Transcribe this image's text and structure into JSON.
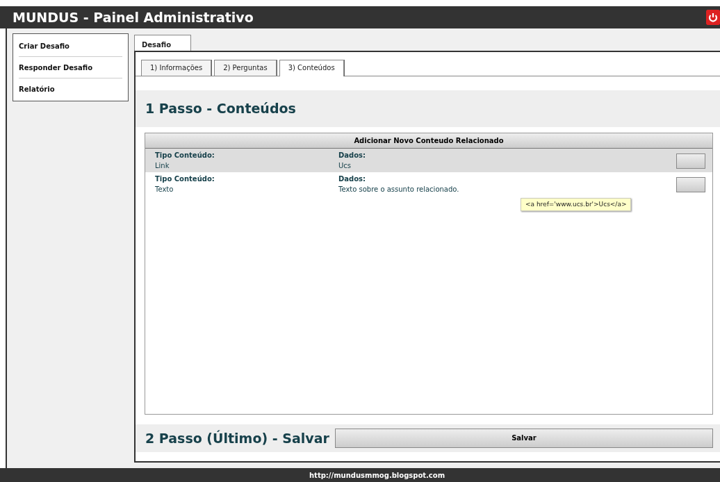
{
  "header": {
    "title": "MUNDUS - Painel Administrativo"
  },
  "sidebar": {
    "items": [
      {
        "label": "Criar Desafio"
      },
      {
        "label": "Responder Desafio"
      },
      {
        "label": "Relatório"
      }
    ]
  },
  "main_tabs": [
    {
      "label": "Desafio",
      "selected": true
    }
  ],
  "step_tabs": [
    {
      "label": "1) Informações",
      "selected": false
    },
    {
      "label": "2) Perguntas",
      "selected": false
    },
    {
      "label": "3) Conteúdos",
      "selected": true
    }
  ],
  "step1": {
    "title": "1 Passo - Conteúdos"
  },
  "contents_table": {
    "add_button": "Adicionar Novo Conteudo Relacionado",
    "rows": [
      {
        "type_label": "Tipo Conteúdo:",
        "type": "Link",
        "data_label": "Dados:",
        "data": "Ucs",
        "highlighted": true
      },
      {
        "type_label": "Tipo Conteúdo:",
        "type": "Texto",
        "data_label": "Dados:",
        "data": "Texto sobre o assunto relacionado.",
        "highlighted": false
      }
    ]
  },
  "tooltip": "<a href='www.ucs.br'>Ucs</a>",
  "step2": {
    "title": "2 Passo (Último) - Salvar",
    "save_button": "Salvar"
  },
  "footer": {
    "url": "http://mundusmmog.blogspot.com"
  }
}
